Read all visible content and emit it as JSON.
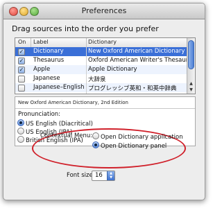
{
  "window": {
    "title": "Preferences"
  },
  "heading": "Drag sources into the order you prefer",
  "table": {
    "headers": {
      "on": "On",
      "label": "Label",
      "dictionary": "Dictionary"
    },
    "rows": [
      {
        "checked": true,
        "label": "Dictionary",
        "dictionary": "New Oxford American Dictionary",
        "selected": true
      },
      {
        "checked": true,
        "label": "Thesaurus",
        "dictionary": "Oxford American Writer's Thesaurus",
        "selected": false
      },
      {
        "checked": true,
        "label": "Apple",
        "dictionary": "Apple Dictionary",
        "selected": false
      },
      {
        "checked": false,
        "label": "Japanese",
        "dictionary": "大辞泉",
        "selected": false
      },
      {
        "checked": false,
        "label": "Japanese–English",
        "dictionary": "プログレッシブ英和・和英中辞典",
        "selected": false
      }
    ]
  },
  "detail": {
    "edition": "New Oxford American Dictionary, 2nd Edition",
    "pronunciation_label": "Pronunciation:",
    "pronunciation_options": [
      {
        "label": "US English (Diacritical)",
        "selected": true
      },
      {
        "label": "US English (IPA)",
        "selected": false
      },
      {
        "label": "British English (IPA)",
        "selected": false
      }
    ]
  },
  "contextual_menu": {
    "label": "Contextual Menu:",
    "options": [
      {
        "label": "Open Dictionary application",
        "selected": false
      },
      {
        "label": "Open Dictionary panel",
        "selected": true
      }
    ],
    "highlight_color": "#d0202a"
  },
  "font_size": {
    "label": "Font size:",
    "value": "16"
  },
  "colors": {
    "selection": "#3a6fd7",
    "window_bg": "#ededed"
  }
}
